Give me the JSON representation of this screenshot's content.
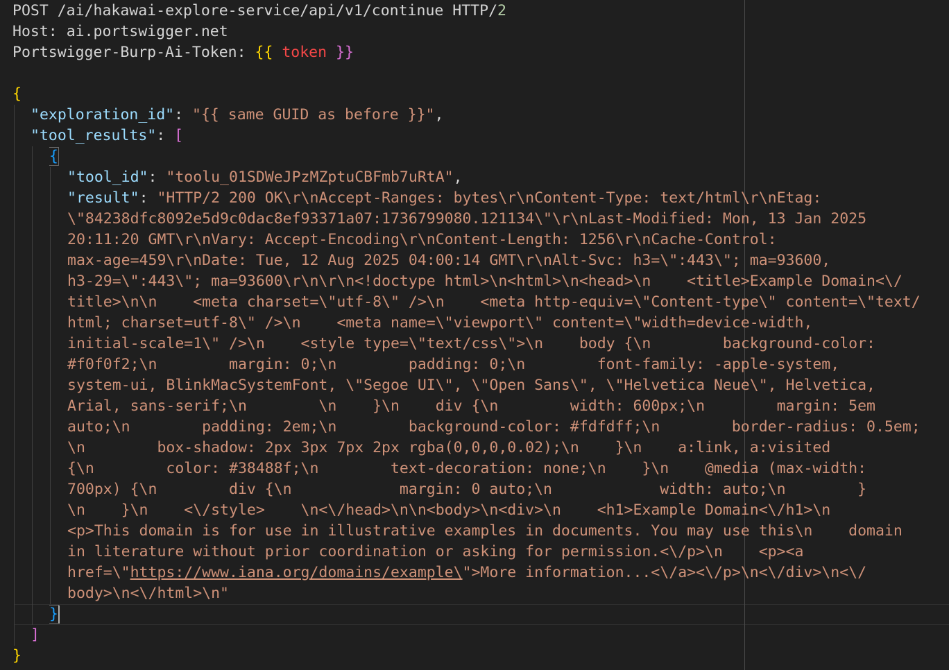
{
  "request": {
    "method": "POST",
    "path": "/ai/hakawai-explore-service/api/v1/continue",
    "protocol": "HTTP/",
    "version": "2",
    "host_label": "Host:",
    "host_value": "ai.portswigger.net",
    "token_header_label": "Portswigger-Burp-Ai-Token:",
    "token_open": "{{",
    "token_name": "token",
    "token_close": "}}"
  },
  "body": {
    "open_brace": "{",
    "exploration_key": "\"exploration_id\"",
    "exploration_value": "\"{{ same GUID as before }}\"",
    "comma": ",",
    "tool_results_key": "\"tool_results\"",
    "open_bracket": "[",
    "item_open": "{",
    "tool_id_key": "\"tool_id\"",
    "tool_id_value": "\"toolu_01SDWeJPzMZptuCBFmb7uRtA\"",
    "result_key": "\"result\"",
    "result_lines": [
      "\"HTTP/2 200 OK\\r\\nAccept-Ranges: bytes\\r\\nContent-Type: text/html\\r\\nEtag:",
      "\\\"84238dfc8092e5d9c0dac8ef93371a07:1736799080.121134\\\"\\r\\nLast-Modified: Mon, 13 Jan 2025",
      "20:11:20 GMT\\r\\nVary: Accept-Encoding\\r\\nContent-Length: 1256\\r\\nCache-Control:",
      "max-age=459\\r\\nDate: Tue, 12 Aug 2025 04:00:14 GMT\\r\\nAlt-Svc: h3=\\\":443\\\"; ma=93600,",
      "h3-29=\\\":443\\\"; ma=93600\\r\\n\\r\\n<!doctype html>\\n<html>\\n<head>\\n    <title>Example Domain<\\/",
      "title>\\n\\n    <meta charset=\\\"utf-8\\\" />\\n    <meta http-equiv=\\\"Content-type\\\" content=\\\"text/",
      "html; charset=utf-8\\\" />\\n    <meta name=\\\"viewport\\\" content=\\\"width=device-width,",
      "initial-scale=1\\\" />\\n    <style type=\\\"text/css\\\">\\n    body {\\n        background-color:",
      "#f0f0f2;\\n        margin: 0;\\n        padding: 0;\\n        font-family: -apple-system,",
      "system-ui, BlinkMacSystemFont, \\\"Segoe UI\\\", \\\"Open Sans\\\", \\\"Helvetica Neue\\\", Helvetica,",
      "Arial, sans-serif;\\n        \\n    }\\n    div {\\n        width: 600px;\\n        margin: 5em",
      "auto;\\n        padding: 2em;\\n        background-color: #fdfdff;\\n        border-radius: 0.5em;",
      "\\n        box-shadow: 2px 3px 7px 2px rgba(0,0,0,0.02);\\n    }\\n    a:link, a:visited",
      "{\\n        color: #38488f;\\n        text-decoration: none;\\n    }\\n    @media (max-width:",
      "700px) {\\n        div {\\n            margin: 0 auto;\\n            width: auto;\\n        }",
      "\\n    }\\n    <\\/style>    \\n<\\/head>\\n\\n<body>\\n<div>\\n    <h1>Example Domain<\\/h1>\\n",
      "<p>This domain is for use in illustrative examples in documents. You may use this\\n    domain",
      "in literature without prior coordination or asking for permission.<\\/p>\\n    <p><a"
    ],
    "link_prefix": "href=\\\"",
    "link_url": "https://www.iana.org/domains/example\\",
    "link_suffix": "\">More information...<\\/a><\\/p>\\n<\\/div>\\n<\\/",
    "result_last_line": "body>\\n<\\/html>\\n\"",
    "item_close": "}",
    "close_bracket": "]",
    "close_brace": "}"
  },
  "colors": {
    "background": "#1f1f1f",
    "key": "#9cdcfe",
    "string": "#ce9178",
    "brace_level1": "#ffd700",
    "bracket_level2": "#da70d6",
    "brace_level3": "#179fff",
    "token": "#f44747"
  }
}
